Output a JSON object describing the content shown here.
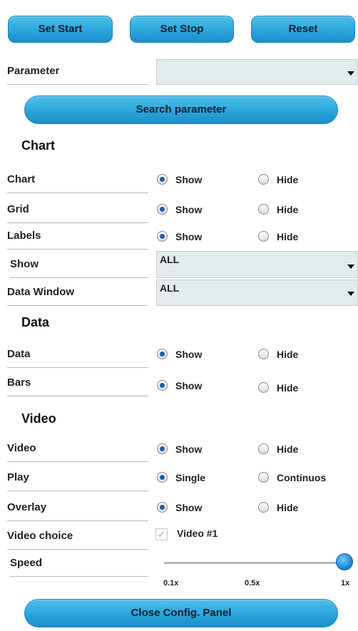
{
  "buttons": {
    "set_start": "Set Start",
    "set_stop": "Set Stop",
    "reset": "Reset"
  },
  "parameter": {
    "label": "Parameter",
    "value": ""
  },
  "search_button": "Search parameter",
  "sections": {
    "chart": "Chart",
    "data": "Data",
    "video": "Video"
  },
  "radio_rows": [
    {
      "label": "Chart",
      "opt1": "Show",
      "opt2": "Hide",
      "selected": 1
    },
    {
      "label": "Grid",
      "opt1": "Show",
      "opt2": "Hide",
      "selected": 1
    },
    {
      "label": "Labels",
      "opt1": "Show",
      "opt2": "Hide",
      "selected": 1
    },
    {
      "label": "Data",
      "opt1": "Show",
      "opt2": "Hide",
      "selected": 1
    },
    {
      "label": "Bars",
      "opt1": "Show",
      "opt2": "Hide",
      "selected": 1
    },
    {
      "label": "Video",
      "opt1": "Show",
      "opt2": "Hide",
      "selected": 1
    },
    {
      "label": "Play",
      "opt1": "Single",
      "opt2": "Continuos",
      "selected": 1
    },
    {
      "label": "Overlay",
      "opt1": "Show",
      "opt2": "Hide",
      "selected": 1
    }
  ],
  "selects": {
    "show": {
      "label": "Show",
      "value": "ALL"
    },
    "data_window": {
      "label": "Data Window",
      "value": "ALL"
    }
  },
  "video_choice": {
    "label": "Video choice",
    "option": "Video #1",
    "checked": true
  },
  "speed": {
    "label": "Speed",
    "ticks": [
      "0.1x",
      "0.5x",
      "1x"
    ],
    "value": "1x"
  },
  "close_button": "Close Config. Panel",
  "colors": {
    "accent": "#2aa6dc",
    "select_bg": "#e4ebee",
    "radio_dot": "#1f5fa8"
  },
  "icons": {
    "select_arrow": "chevron-down-icon"
  }
}
